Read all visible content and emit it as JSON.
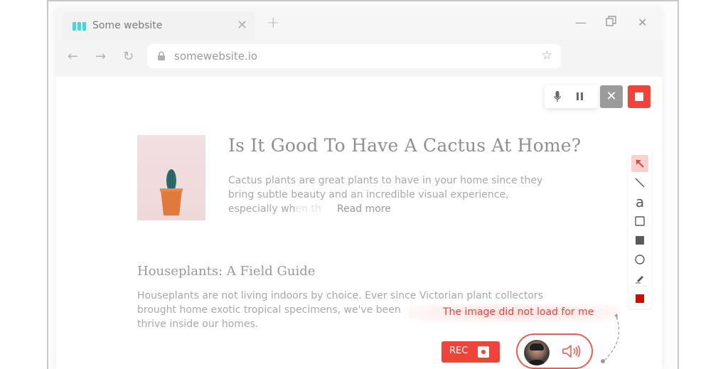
{
  "browser": {
    "tab": {
      "title": "Some website",
      "logo_color": "#3fd8dc"
    },
    "new_tab_label": "+",
    "window_controls": {
      "minimize": "—",
      "restore": "❐",
      "close": "✕"
    },
    "nav": {
      "back": "←",
      "forward": "→",
      "reload": "↻"
    },
    "address": {
      "url": "somewebsite.io",
      "bookmark": "☆"
    }
  },
  "recording_controls": {
    "mic_icon": "mic",
    "pause_icon": "pause",
    "cancel_label": "✕",
    "stop_color": "#f0443b"
  },
  "annotation_toolbar": {
    "tools": [
      {
        "name": "arrow",
        "glyph": "➚",
        "active": true
      },
      {
        "name": "line",
        "glyph": "╲"
      },
      {
        "name": "text",
        "glyph": "a"
      },
      {
        "name": "rectangle",
        "glyph": "□"
      },
      {
        "name": "filled-rectangle",
        "glyph": "■"
      },
      {
        "name": "circle",
        "glyph": "○"
      },
      {
        "name": "pen",
        "glyph": "✎"
      }
    ],
    "current_color": "#cc0a00"
  },
  "article": {
    "title": "Is It Good To Have A Cactus At Home?",
    "body_line1": "Cactus plants are great plants to have in your home since they",
    "body_line2": "bring subtle beauty and an incredible visual experience,",
    "body_line3_start": "especially wh",
    "body_line3_fade": "en th",
    "read_more": "Read more"
  },
  "section": {
    "title": "Houseplants: A Field Guide",
    "body_line1": "Houseplants are not living indoors by choice. Ever since Victorian plant collectors",
    "body_line2": "brought home exotic tropical specimens, we've been",
    "body_line3": "thrive inside our homes."
  },
  "comment": {
    "text": "The image did not load for me",
    "color": "#e8453c"
  },
  "rec_button": {
    "label": "REC"
  },
  "voice_comment": {
    "speaker_icon": "speaker",
    "accent": "#ef5a52"
  }
}
